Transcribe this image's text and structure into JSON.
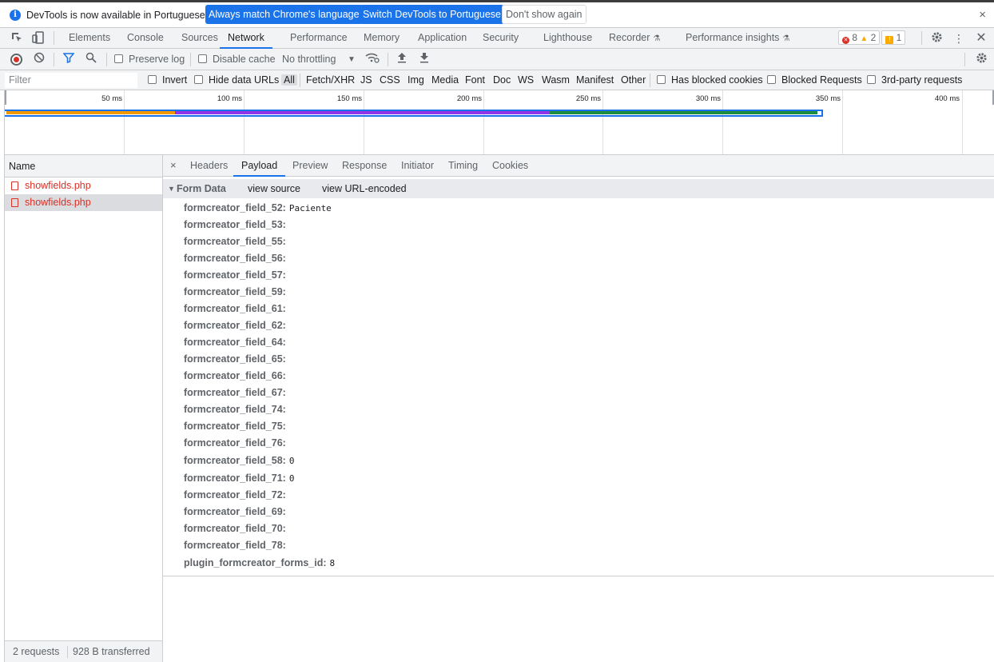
{
  "infobar": {
    "message": "DevTools is now available in Portuguese!",
    "match_button": "Always match Chrome's language",
    "switch_button": "Switch DevTools to Portuguese",
    "dismiss_button": "Don't show again",
    "close": "×"
  },
  "main_tabs": {
    "elements": "Elements",
    "console": "Console",
    "sources": "Sources",
    "network": "Network",
    "performance": "Performance",
    "memory": "Memory",
    "application": "Application",
    "security": "Security",
    "lighthouse": "Lighthouse",
    "recorder": "Recorder",
    "performance_insights": "Performance insights"
  },
  "counts": {
    "errors": "8",
    "warnings": "2",
    "issues": "1"
  },
  "network_toolbar": {
    "preserve_log": "Preserve log",
    "disable_cache": "Disable cache",
    "throttling": "No throttling"
  },
  "filter_bar": {
    "filter_placeholder": "Filter",
    "invert": "Invert",
    "hide_data_urls": "Hide data URLs",
    "types": [
      "All",
      "Fetch/XHR",
      "JS",
      "CSS",
      "Img",
      "Media",
      "Font",
      "Doc",
      "WS",
      "Wasm",
      "Manifest",
      "Other"
    ],
    "blocked_cookies": "Has blocked cookies",
    "blocked_requests": "Blocked Requests",
    "third_party": "3rd-party requests"
  },
  "overview": {
    "ticks": [
      "50 ms",
      "100 ms",
      "150 ms",
      "200 ms",
      "250 ms",
      "300 ms",
      "350 ms",
      "400 ms"
    ],
    "colors": {
      "waiting": "#f29900",
      "download": "#9334e6",
      "script": "#1e8e3e",
      "frame": "#1a73e8"
    }
  },
  "requests": {
    "header": "Name",
    "items": [
      "showfields.php",
      "showfields.php"
    ],
    "footer_requests": "2 requests",
    "footer_transferred": "928 B transferred"
  },
  "detail_tabs": {
    "close": "×",
    "headers": "Headers",
    "payload": "Payload",
    "preview": "Preview",
    "response": "Response",
    "initiator": "Initiator",
    "timing": "Timing",
    "cookies": "Cookies"
  },
  "form_data": {
    "title": "Form Data",
    "view_source": "view source",
    "view_url_encoded": "view URL-encoded",
    "fields": [
      {
        "key": "formcreator_field_52:",
        "value": "Paciente"
      },
      {
        "key": "formcreator_field_53:",
        "value": ""
      },
      {
        "key": "formcreator_field_55:",
        "value": ""
      },
      {
        "key": "formcreator_field_56:",
        "value": ""
      },
      {
        "key": "formcreator_field_57:",
        "value": ""
      },
      {
        "key": "formcreator_field_59:",
        "value": ""
      },
      {
        "key": "formcreator_field_61:",
        "value": ""
      },
      {
        "key": "formcreator_field_62:",
        "value": ""
      },
      {
        "key": "formcreator_field_64:",
        "value": ""
      },
      {
        "key": "formcreator_field_65:",
        "value": ""
      },
      {
        "key": "formcreator_field_66:",
        "value": ""
      },
      {
        "key": "formcreator_field_67:",
        "value": ""
      },
      {
        "key": "formcreator_field_74:",
        "value": ""
      },
      {
        "key": "formcreator_field_75:",
        "value": ""
      },
      {
        "key": "formcreator_field_76:",
        "value": ""
      },
      {
        "key": "formcreator_field_58:",
        "value": "0"
      },
      {
        "key": "formcreator_field_71:",
        "value": "0"
      },
      {
        "key": "formcreator_field_72:",
        "value": ""
      },
      {
        "key": "formcreator_field_69:",
        "value": ""
      },
      {
        "key": "formcreator_field_70:",
        "value": ""
      },
      {
        "key": "formcreator_field_78:",
        "value": ""
      },
      {
        "key": "plugin_formcreator_forms_id:",
        "value": "8"
      }
    ]
  }
}
